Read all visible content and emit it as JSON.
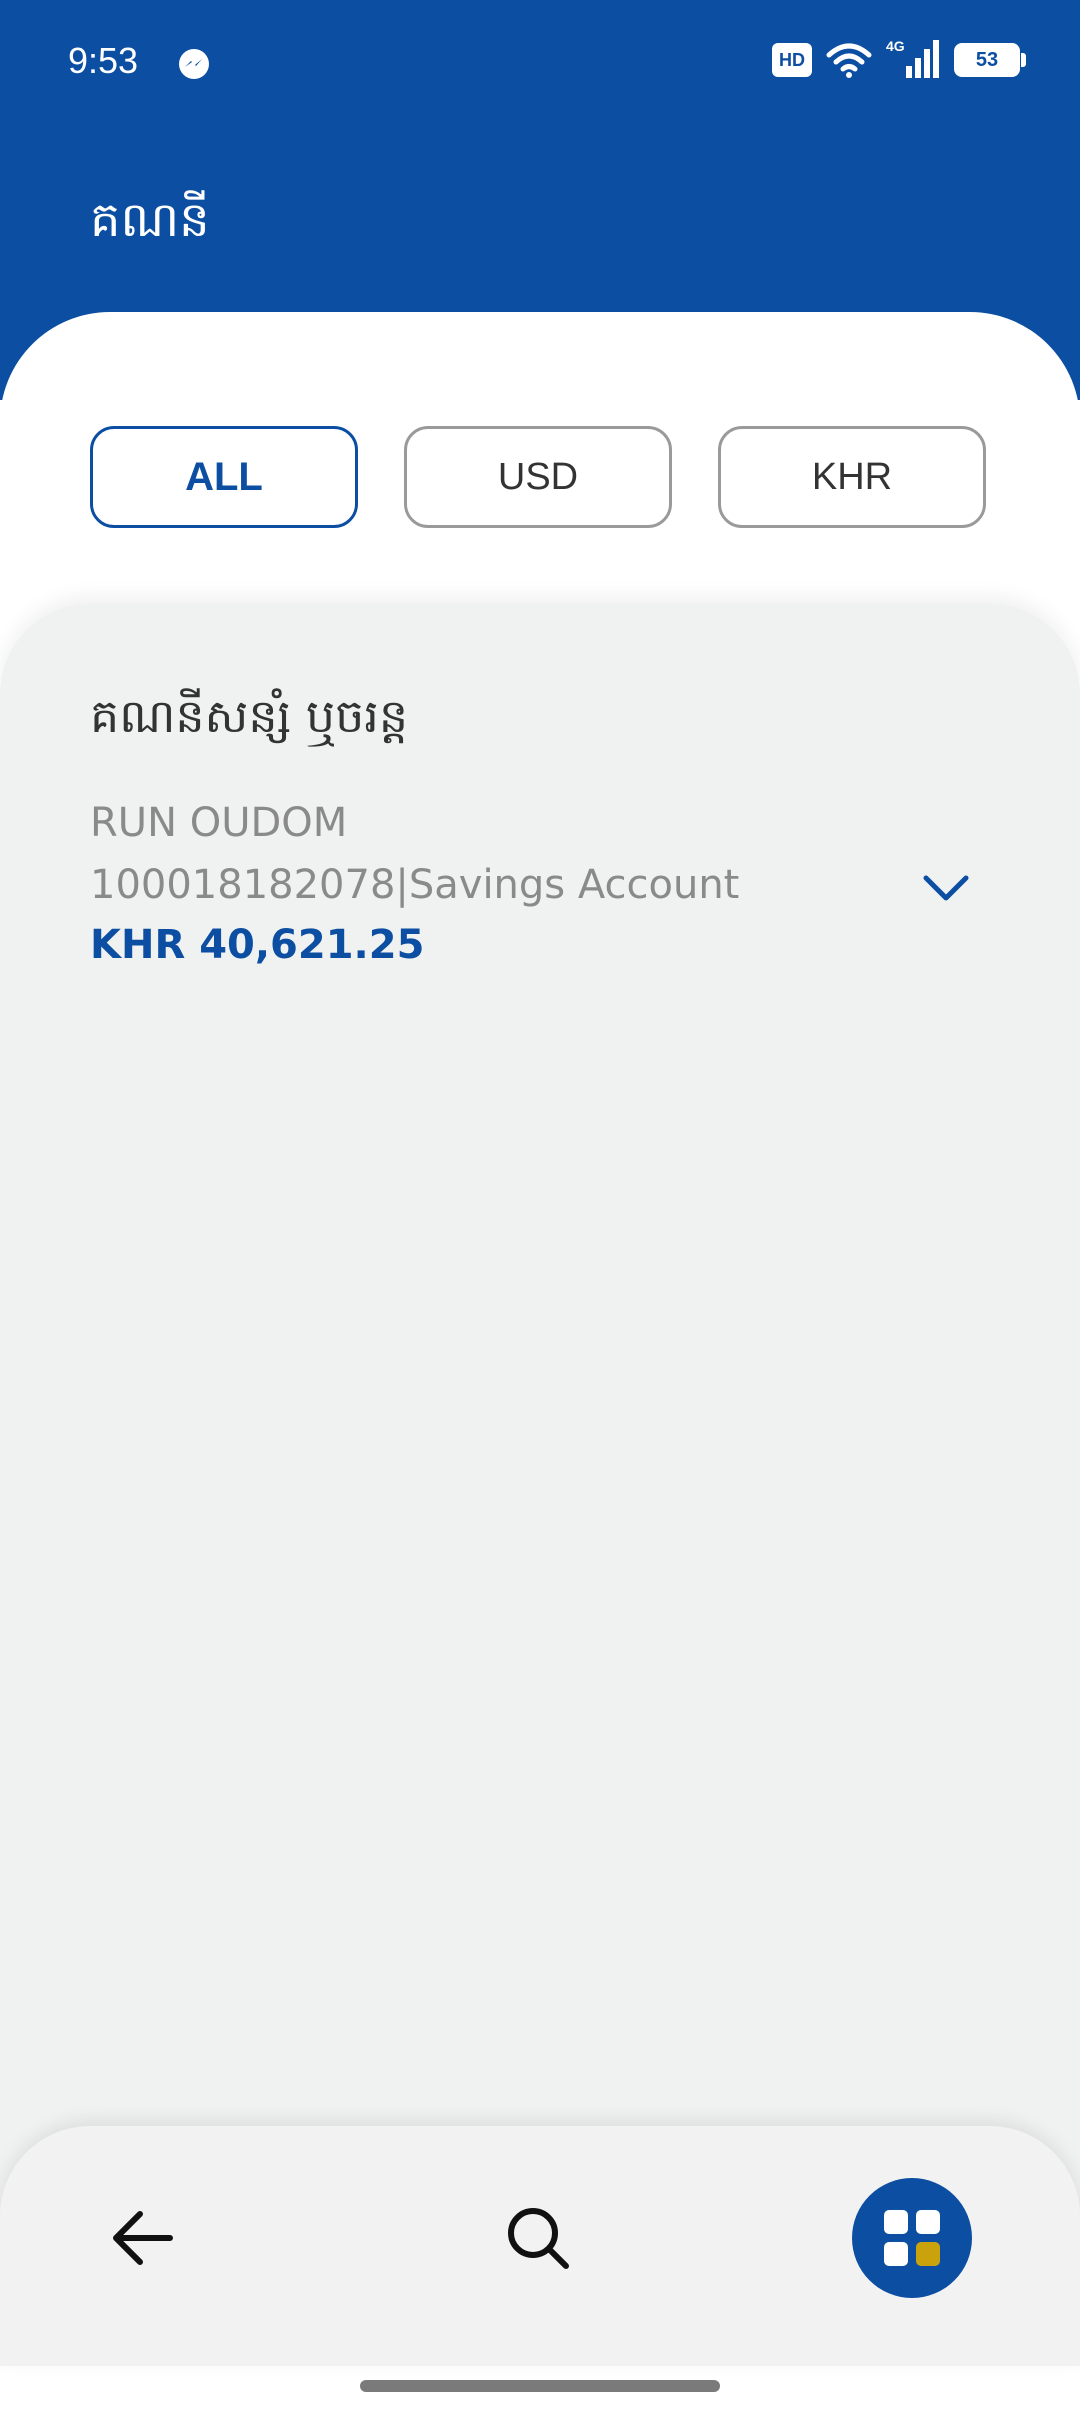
{
  "status_bar": {
    "time": "9:53",
    "hd_label": "HD",
    "network_label": "4G",
    "battery_level": "53",
    "icons": [
      "messenger-icon",
      "wifi-icon",
      "signal-icon",
      "battery-icon"
    ]
  },
  "header": {
    "title": "គណនី"
  },
  "filters": {
    "chips": [
      "ALL",
      "USD",
      "KHR"
    ],
    "selected": "ALL"
  },
  "accounts_section": {
    "title": "គណនីសន្សំ ឬចរន្ត",
    "account": {
      "holder_name": "RUN OUDOM",
      "number_and_type": "100018182078|Savings Account",
      "balance": "KHR 40,621.25"
    }
  },
  "bottom_nav": {
    "items": [
      "back-arrow-icon",
      "search-icon",
      "menu-grid-icon"
    ]
  },
  "colors": {
    "primary": "#0c4ea2",
    "accent": "#c9a20c",
    "panel_bg": "#f0f1f1",
    "muted_text": "#8a8a8a"
  }
}
